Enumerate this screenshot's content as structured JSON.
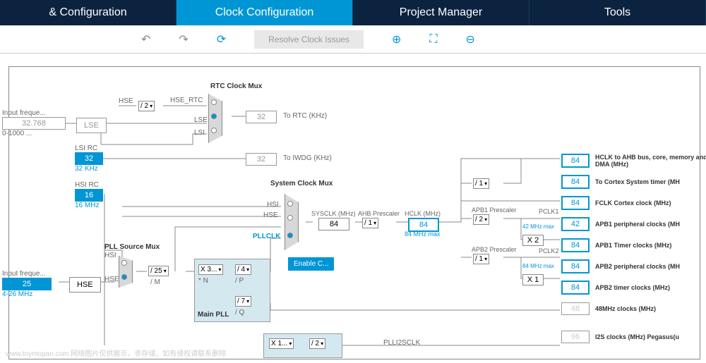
{
  "tabs": [
    "& Configuration",
    "Clock Configuration",
    "Project Manager",
    "Tools"
  ],
  "toolbar": {
    "resolve": "Resolve Clock Issues"
  },
  "inputs": {
    "lse_label": "Input freque...",
    "lse_val": "32.768",
    "lse_range": "0-1000 ...",
    "lse_name": "LSE",
    "lsi_name": "LSI RC",
    "lsi_val": "32",
    "lsi_unit": "32 KHz",
    "hsi_name": "HSI RC",
    "hsi_val": "16",
    "hsi_unit": "16 MHz",
    "hse_label": "Input freque...",
    "hse_val": "25",
    "hse_range": "4-26 MHz",
    "hse_name": "HSE"
  },
  "rtc": {
    "title": "RTC Clock Mux",
    "div": "/ 2",
    "hse": "HSE",
    "hse_rtc": "HSE_RTC",
    "lse": "LSE",
    "lsi": "LSI",
    "rtc_val": "32",
    "rtc_label": "To RTC (KHz)",
    "iwdg_val": "32",
    "iwdg_label": "To IWDG (KHz)"
  },
  "pllsrc": {
    "title": "PLL Source Mux",
    "hsi": "HSI",
    "hse": "HSE",
    "div_m": "/ 25",
    "div_m_label": "/ M"
  },
  "mainpll": {
    "title": "Main PLL",
    "n": "X 3...",
    "n_label": "* N",
    "p": "/ 4",
    "p_label": "/ P",
    "q": "/ 7",
    "q_label": "/ Q"
  },
  "sysclk": {
    "title": "System Clock Mux",
    "hsi": "HSI",
    "hse": "HSE",
    "pllclk": "PLLCLK",
    "enable": "Enable C...",
    "sysclk_label": "SYSCLK (MHz)",
    "sysclk_val": "84",
    "ahb_label": "AHB Prescaler",
    "ahb_div": "/ 1",
    "hclk_label": "HCLK (MHz)",
    "hclk_val": "84",
    "hclk_max": "84 MHz  max"
  },
  "out": {
    "en_div": "/ 1",
    "apb1_title": "APB1 Prescaler",
    "apb1_div": "/ 2",
    "pclk1": "PCLK1",
    "pclk1_max": "42 MHz  max",
    "apb1_x": "X 2",
    "apb2_title": "APB2 Prescaler",
    "apb2_div": "/ 1",
    "pclk2": "PCLK2",
    "pclk2_max": "84 MHz  max",
    "apb2_x": "X 1",
    "rows": [
      {
        "val": "84",
        "label": "HCLK to AHB bus, core, memory and DMA (MHz)"
      },
      {
        "val": "84",
        "label": "To Cortex System timer (MH"
      },
      {
        "val": "84",
        "label": "FCLK Cortex clock (MHz)"
      },
      {
        "val": "42",
        "label": "APB1 peripheral clocks (MH"
      },
      {
        "val": "84",
        "label": "APB1 Timer clocks (MHz)"
      },
      {
        "val": "84",
        "label": "APB2 peripheral clocks (MH"
      },
      {
        "val": "84",
        "label": "APB2 timer clocks (MHz)"
      },
      {
        "val": "48",
        "label": "48MHz clocks (MHz)"
      },
      {
        "val": "96",
        "label": "I2S clocks (MHz) Pegasus(u"
      }
    ]
  },
  "plli2s": {
    "n": "X 1...",
    "p": "/ 2",
    "label": "PLLI2SCLK"
  },
  "watermark": "www.toymopan.com  网络图片仅供展示，非存储，如有侵权请联系删除"
}
